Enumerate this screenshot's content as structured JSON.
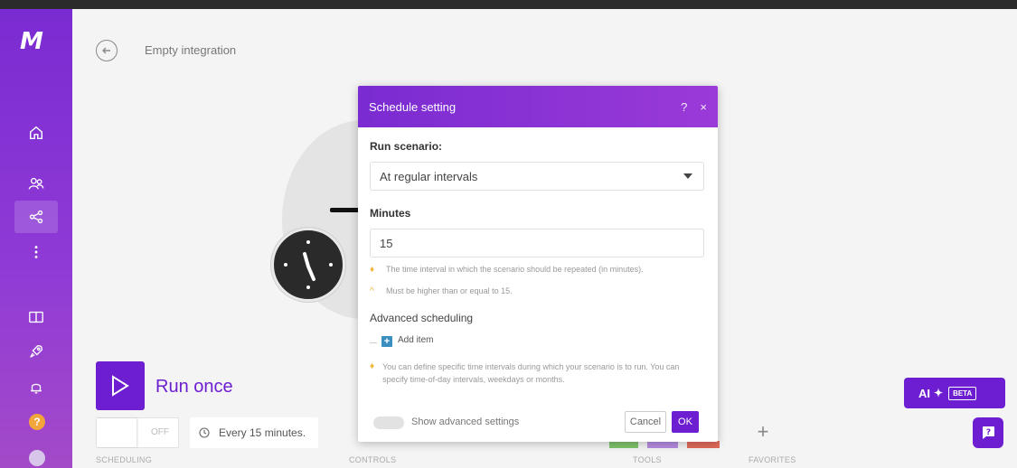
{
  "header": {
    "title": "Empty integration"
  },
  "sidebar": {
    "logo": "M",
    "items": [
      {
        "name": "home-icon"
      },
      {
        "name": "team-icon"
      },
      {
        "name": "share-icon"
      },
      {
        "name": "more-icon"
      },
      {
        "name": "book-icon"
      },
      {
        "name": "rocket-icon"
      },
      {
        "name": "bell-icon"
      }
    ],
    "help": "?"
  },
  "canvas": {
    "run_once_label": "Run once"
  },
  "toolbar": {
    "toggle_text": "OFF",
    "schedule_text": "Every 15 minutes.",
    "sections": {
      "scheduling": "SCHEDULING",
      "controls": "CONTROLS",
      "tools": "TOOLS",
      "favorites": "FAVORITES"
    },
    "fav_plus": "+"
  },
  "ai_button": {
    "label": "AI",
    "badge": "BETA"
  },
  "dialog": {
    "title": "Schedule setting",
    "help": "?",
    "close": "×",
    "run_label": "Run scenario:",
    "run_value": "At regular intervals",
    "minutes_label": "Minutes",
    "minutes_value": "15",
    "hint1": "The time interval in which the scenario should be repeated (in minutes).",
    "hint2": "Must be higher than or equal to 15.",
    "advanced_head": "Advanced scheduling",
    "add_item": "Add item",
    "hint3": "You can define specific time intervals during which your scenario is to run. You can specify time-of-day intervals, weekdays or months.",
    "show_advanced": "Show advanced settings",
    "cancel": "Cancel",
    "ok": "OK"
  },
  "colors": {
    "brand": "#6d1ed0",
    "sidebar": "#7a2bd1",
    "warning": "#f2b53a"
  }
}
